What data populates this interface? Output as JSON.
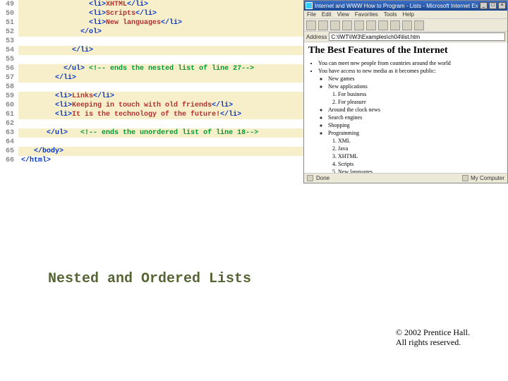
{
  "code": {
    "lines": [
      {
        "n": "49",
        "ind": 16,
        "parts": [
          {
            "t": "tag",
            "v": "<li>"
          },
          {
            "t": "txt",
            "v": "XHTML"
          },
          {
            "t": "tag",
            "v": "</li>"
          }
        ]
      },
      {
        "n": "50",
        "ind": 16,
        "parts": [
          {
            "t": "tag",
            "v": "<li>"
          },
          {
            "t": "txt",
            "v": "Scripts"
          },
          {
            "t": "tag",
            "v": "</li>"
          }
        ]
      },
      {
        "n": "51",
        "ind": 16,
        "parts": [
          {
            "t": "tag",
            "v": "<li>"
          },
          {
            "t": "txt",
            "v": "New languages"
          },
          {
            "t": "tag",
            "v": "</li>"
          }
        ]
      },
      {
        "n": "52",
        "ind": 14,
        "parts": [
          {
            "t": "tag",
            "v": "</ol>"
          }
        ]
      },
      {
        "n": "53",
        "ind": 0,
        "parts": []
      },
      {
        "n": "54",
        "ind": 12,
        "parts": [
          {
            "t": "tag",
            "v": "</li>"
          }
        ]
      },
      {
        "n": "55",
        "ind": 0,
        "parts": []
      },
      {
        "n": "56",
        "ind": 10,
        "parts": [
          {
            "t": "tag",
            "v": "</ul>"
          },
          {
            "t": "txt",
            "v": " "
          },
          {
            "t": "cmt",
            "v": "<!-- ends the nested list of line 27-->"
          }
        ]
      },
      {
        "n": "57",
        "ind": 8,
        "parts": [
          {
            "t": "tag",
            "v": "</li>"
          }
        ]
      },
      {
        "n": "58",
        "ind": 0,
        "parts": []
      },
      {
        "n": "59",
        "ind": 8,
        "parts": [
          {
            "t": "tag",
            "v": "<li>"
          },
          {
            "t": "txt",
            "v": "Links"
          },
          {
            "t": "tag",
            "v": "</li>"
          }
        ]
      },
      {
        "n": "60",
        "ind": 8,
        "parts": [
          {
            "t": "tag",
            "v": "<li>"
          },
          {
            "t": "txt",
            "v": "Keeping in touch with old friends"
          },
          {
            "t": "tag",
            "v": "</li>"
          }
        ]
      },
      {
        "n": "61",
        "ind": 8,
        "parts": [
          {
            "t": "tag",
            "v": "<li>"
          },
          {
            "t": "txt",
            "v": "It is the technology of the future!"
          },
          {
            "t": "tag",
            "v": "</li>"
          }
        ]
      },
      {
        "n": "62",
        "ind": 0,
        "parts": []
      },
      {
        "n": "63",
        "ind": 6,
        "parts": [
          {
            "t": "tag",
            "v": "</ul>"
          },
          {
            "t": "txt",
            "v": "   "
          },
          {
            "t": "cmt",
            "v": "<!-- ends the unordered list of line 18-->"
          }
        ]
      },
      {
        "n": "64",
        "ind": 0,
        "parts": []
      },
      {
        "n": "65",
        "ind": 3,
        "parts": [
          {
            "t": "tag",
            "v": "</body>"
          }
        ]
      },
      {
        "n": "66",
        "ind": 0,
        "parts": [
          {
            "t": "tag",
            "v": "</html>"
          }
        ],
        "whiteBg": true
      }
    ]
  },
  "browser": {
    "title": "Internet and WWW How to Program - Lists - Microsoft Internet Explorer",
    "menus": [
      "File",
      "Edit",
      "View",
      "Favorites",
      "Tools",
      "Help"
    ],
    "address_label": "Address",
    "address_value": "C:\\IWT\\IW3\\Examples\\ch04\\list.htm",
    "heading": "The Best Features of the Internet",
    "ul1": [
      "You can meet new people from countries around the world",
      "You have access to new media as it becomes public:"
    ],
    "ul2": [
      "New games",
      "New applications"
    ],
    "ol1": [
      "For business",
      "For pleasure"
    ],
    "ul2b": [
      "Around the clock news",
      "Search engines",
      "Shopping",
      "Programming"
    ],
    "ol2": [
      "XML",
      "Java",
      "XHTML",
      "Scripts",
      "New languages"
    ],
    "ul1b": [
      "Links",
      "Keeping in touch with old friends",
      "It is the technology of the future!"
    ],
    "status_left": "Done",
    "status_right": "My Computer"
  },
  "caption": "Nested and Ordered Lists",
  "copyright_line1": "© 2002 Prentice Hall.",
  "copyright_line2": "All rights reserved."
}
